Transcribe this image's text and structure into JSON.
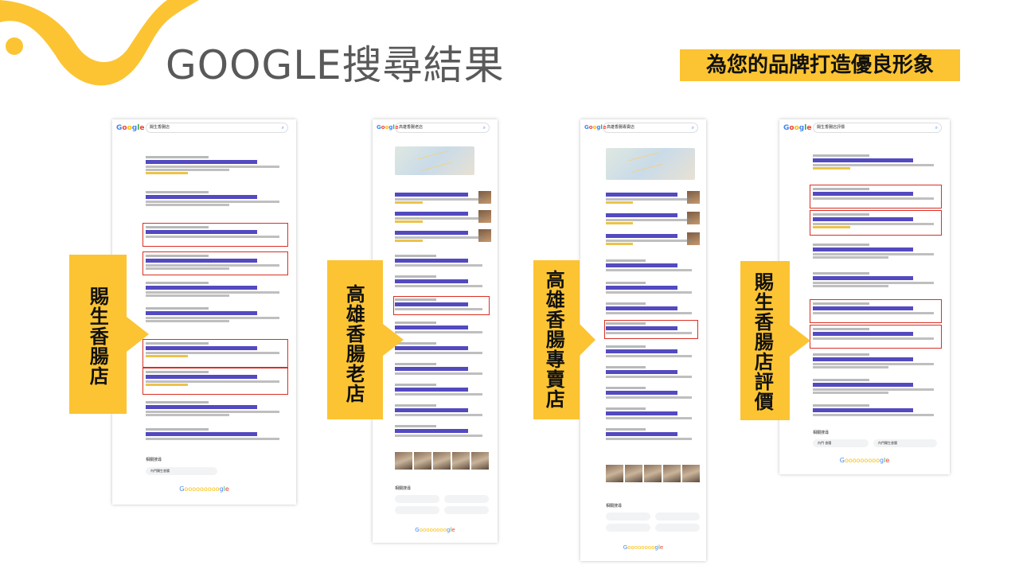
{
  "slide": {
    "title": "GOOGLE搜尋結果",
    "tagline": "為您的品牌打造優良形象"
  },
  "colors": {
    "accent_yellow": "#fcc433",
    "title_gray": "#595959",
    "highlight_red": "#d93025"
  },
  "keywords": [
    "賜生香腸店",
    "高雄香腸老店",
    "高雄香腸專賣店",
    "賜生香腸店評價"
  ],
  "screenshots": [
    {
      "query": "賜生香腸店",
      "related_title": "相關搜尋",
      "related": [
        "內門賜生香腸"
      ]
    },
    {
      "query": "高雄香腸老店",
      "related_title": "相關搜尋",
      "related": []
    },
    {
      "query": "高雄香腸專賣店",
      "related_title": "相關搜尋",
      "related": []
    },
    {
      "query": "賜生香腸店評價",
      "related_title": "相關搜尋",
      "related": [
        "內門 香腸",
        "內門賜生香腸"
      ]
    }
  ],
  "icons": [
    "google-logo-icon",
    "search-icon",
    "mic-icon",
    "arrow-right-callout-icon",
    "wave-decoration-icon"
  ]
}
